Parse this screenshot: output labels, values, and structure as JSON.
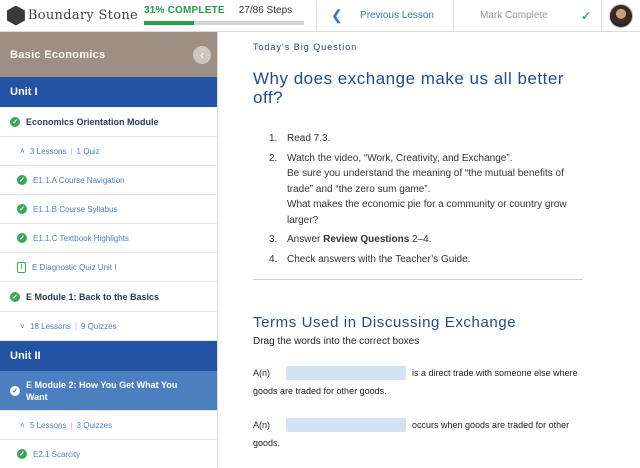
{
  "header": {
    "logo_text": "Boundary Stone",
    "progress_label": "31% COMPLETE",
    "progress_fraction": 0.31,
    "steps_label": "27/86 Steps",
    "previous_label": "Previous Lesson",
    "mark_complete_label": "Mark Complete",
    "accent_color": "#2a9d4a"
  },
  "sidebar": {
    "course_title": "Basic Economics",
    "unit1": {
      "title": "Unit I",
      "module1": {
        "title": "Economics Orientation Module",
        "lessons": "3 Lessons",
        "quizzes": "1 Quiz",
        "items": [
          "E1.1.A Course Navigation",
          "E1.1.B Course Syllabus",
          "E1.1.C Textbook Highlights"
        ],
        "quiz_item": "E Diagnostic Quiz Unit I"
      },
      "module2": {
        "title": "E Module 1: Back to the Basics",
        "lessons": "18 Lessons",
        "quizzes": "9 Quizzes"
      }
    },
    "unit2": {
      "title": "Unit II",
      "module": {
        "title": "E Module 2: How You Get What You Want",
        "lessons": "5 Lessons",
        "quizzes": "3 Quizzes",
        "items": [
          "E2.1 Scarcity"
        ]
      }
    }
  },
  "main": {
    "eyebrow": "Today's Big Question",
    "headline": "Why does exchange make us all better off?",
    "steps": [
      {
        "num": "1.",
        "text": "Read 7.3."
      },
      {
        "num": "2.",
        "text": "Watch the video, “Work, Creativity, and Exchange”.",
        "sub1": "Be sure you understand the meaning of “the mutual benefits of trade” and “the zero sum game”.",
        "sub2": "What makes the economic pie for a community or country grow larger?"
      },
      {
        "num": "3.",
        "text_pre": "Answer ",
        "text_bold": "Review Questions",
        "text_post": " 2–4."
      },
      {
        "num": "4.",
        "text": "Check answers with the Teacher’s Guide."
      }
    ],
    "terms_title": "Terms Used in Discussing Exchange",
    "instruction": "Drag the words into the correct boxes",
    "fill_in": [
      {
        "prefix": "A(n)",
        "suffix": "is a direct trade with someone else where",
        "continuation": "goods are traded for other goods."
      },
      {
        "prefix": "A(n)",
        "suffix": "occurs when goods are traded for other",
        "continuation": "goods."
      }
    ]
  }
}
